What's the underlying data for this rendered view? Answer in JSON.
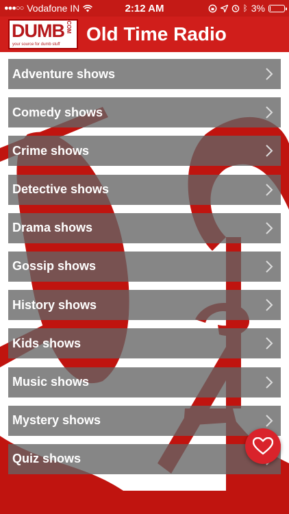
{
  "status_bar": {
    "carrier": "Vodafone IN",
    "time": "2:12 AM",
    "battery": "3%",
    "battery_level": 0.03
  },
  "header": {
    "logo_text": "DUMB",
    "logo_com": ".COM",
    "logo_tagline": "your source for dumb stuff",
    "title": "Old Time Radio"
  },
  "categories": [
    {
      "label": "Adventure shows"
    },
    {
      "label": "Comedy shows"
    },
    {
      "label": "Crime shows"
    },
    {
      "label": "Detective shows"
    },
    {
      "label": "Drama shows"
    },
    {
      "label": "Gossip shows"
    },
    {
      "label": "History shows"
    },
    {
      "label": "Kids shows"
    },
    {
      "label": "Music shows"
    },
    {
      "label": "Mystery shows"
    },
    {
      "label": "Quiz shows"
    }
  ],
  "colors": {
    "accent": "#d01e1b",
    "row": "#646464",
    "fab": "#d9232b"
  },
  "icons": {
    "fab": "heart-icon",
    "row": "chevron-right-icon"
  }
}
